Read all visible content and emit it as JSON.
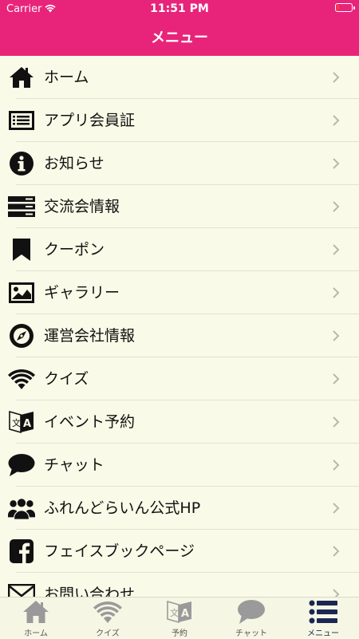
{
  "status_bar": {
    "carrier": "Carrier",
    "time": "11:51 PM"
  },
  "navbar": {
    "title": "メニュー"
  },
  "menu": {
    "items": [
      {
        "label": "ホーム",
        "icon": "home-icon"
      },
      {
        "label": "アプリ会員証",
        "icon": "membership-card-icon"
      },
      {
        "label": "お知らせ",
        "icon": "info-icon"
      },
      {
        "label": "交流会情報",
        "icon": "list-icon"
      },
      {
        "label": "クーポン",
        "icon": "bookmark-icon"
      },
      {
        "label": "ギャラリー",
        "icon": "image-icon"
      },
      {
        "label": "運営会社情報",
        "icon": "compass-icon"
      },
      {
        "label": "クイズ",
        "icon": "wifi-icon"
      },
      {
        "label": "イベント予約",
        "icon": "translate-icon"
      },
      {
        "label": "チャット",
        "icon": "speech-bubble-icon"
      },
      {
        "label": "ふれんどらいん公式HP",
        "icon": "users-icon"
      },
      {
        "label": "フェイスブックページ",
        "icon": "facebook-icon"
      },
      {
        "label": "お問い合わせ",
        "icon": "mail-icon"
      }
    ]
  },
  "tabbar": {
    "tabs": [
      {
        "label": "ホーム",
        "icon": "home-icon",
        "active": false
      },
      {
        "label": "クイズ",
        "icon": "wifi-icon",
        "active": false
      },
      {
        "label": "予約",
        "icon": "translate-icon",
        "active": false
      },
      {
        "label": "チャット",
        "icon": "speech-bubble-icon",
        "active": false
      },
      {
        "label": "メニュー",
        "icon": "menu-list-icon",
        "active": true
      }
    ]
  },
  "colors": {
    "brand": "#e8247a",
    "background": "#fafae8",
    "tab_active": "#1b2753",
    "tab_inactive": "#9a9a9a"
  }
}
